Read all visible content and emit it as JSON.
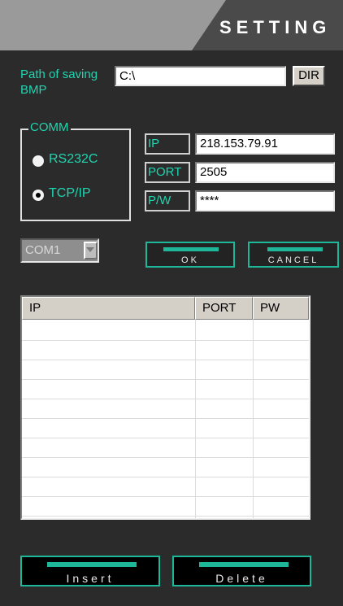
{
  "header": {
    "title": "SETTING"
  },
  "path": {
    "label": "Path of saving BMP",
    "value": "C:\\",
    "dir_label": "DIR"
  },
  "comm": {
    "legend": "COMM",
    "options": [
      {
        "label": "RS232C",
        "selected": false
      },
      {
        "label": "TCP/IP",
        "selected": true
      }
    ]
  },
  "fields": {
    "ip_label": "IP",
    "ip_value": "218.153.79.91",
    "port_label": "PORT",
    "port_value": "2505",
    "pw_label": "P/W",
    "pw_value": "****"
  },
  "com_port": {
    "selected": "COM1"
  },
  "buttons": {
    "ok": "OK",
    "cancel": "CANCEL",
    "insert": "Insert",
    "delete": "Delete"
  },
  "list": {
    "columns": [
      "IP",
      "PORT",
      "PW"
    ],
    "rows": []
  },
  "colors": {
    "accent": "#1fd5b0",
    "background": "#2b2b2b"
  }
}
